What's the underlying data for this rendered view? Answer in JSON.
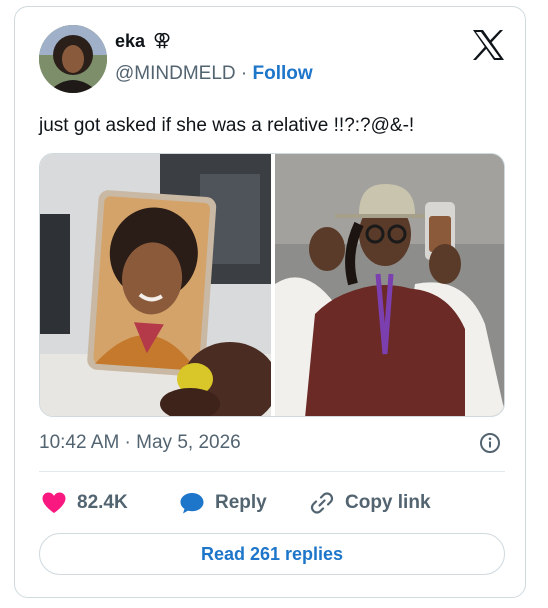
{
  "author": {
    "name": "eka",
    "symbol": "⚢",
    "handle": "@MINDMELD",
    "separator": "·",
    "follow_label": "Follow"
  },
  "tweet": {
    "text": "just got asked if she was a relative !!?:?@&-!"
  },
  "meta": {
    "timestamp": "10:42 AM · May 5, 2026"
  },
  "actions": {
    "likes": "82.4K",
    "reply_label": "Reply",
    "copy_label": "Copy link"
  },
  "read_replies_label": "Read 261 replies",
  "colors": {
    "accent": "#1d76c9",
    "like": "#f91880",
    "muted": "#536471",
    "border": "#cfd9de"
  }
}
